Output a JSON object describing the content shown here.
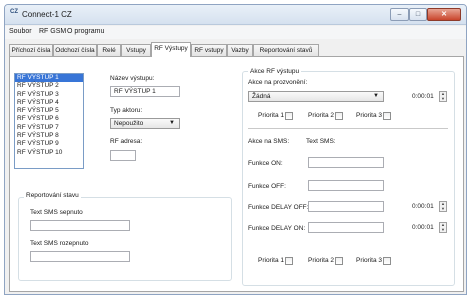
{
  "window": {
    "title": "Connect-1  CZ",
    "icon_name": "app-icon",
    "icon_text": "CZ",
    "controls": {
      "minimize": "–",
      "maximize": "□",
      "close": "✕"
    }
  },
  "menu": [
    "Soubor",
    "RF GSM",
    "O programu"
  ],
  "tabs": [
    "Příchozí čísla",
    "Odchozí čísla",
    "Relé",
    "Vstupy",
    "RF Výstupy",
    "RF vstupy",
    "Vazby",
    "Reportování stavů"
  ],
  "active_tab": "RF Výstupy",
  "outputs_list": [
    "RF VÝSTUP 1",
    "RF VÝSTUP 2",
    "RF VÝSTUP 3",
    "RF VÝSTUP 4",
    "RF VÝSTUP 5",
    "RF VÝSTUP 6",
    "RF VÝSTUP 7",
    "RF VÝSTUP 8",
    "RF VÝSTUP 9",
    "RF VÝSTUP 10"
  ],
  "selected_output_index": 0,
  "output_form": {
    "name_label": "Název výstupu:",
    "name_value": "RF VÝSTUP 1",
    "type_label": "Typ aktoru:",
    "type_value": "Nepoužito",
    "address_label": "RF adresa:",
    "address_value": ""
  },
  "reporting": {
    "group_title": "Reportování stavu",
    "sms_on_label": "Text SMS sepnuto",
    "sms_on_value": "",
    "sms_off_label": "Text SMS rozepnuto",
    "sms_off_value": ""
  },
  "rf_action": {
    "group_title": "Akce RF výstupu",
    "call_label": "Akce na prozvonění:",
    "call_value": "Žádná",
    "call_time": "0:00:01",
    "priorities_top": [
      "Priorita 1",
      "Priorita 2",
      "Priorita 3"
    ],
    "sms_action_label": "Akce na SMS:",
    "sms_text_label": "Text SMS:",
    "func_on_label": "Funkce ON:",
    "func_on_value": "",
    "func_off_label": "Funkce OFF:",
    "func_off_value": "",
    "delay_off_label": "Funkce DELAY OFF:",
    "delay_off_value": "",
    "delay_off_time": "0:00:01",
    "delay_on_label": "Funkce DELAY ON:",
    "delay_on_value": "",
    "delay_on_time": "0:00:01",
    "priorities_bottom": [
      "Priorita 1",
      "Priorita 2",
      "Priorita 3"
    ]
  }
}
